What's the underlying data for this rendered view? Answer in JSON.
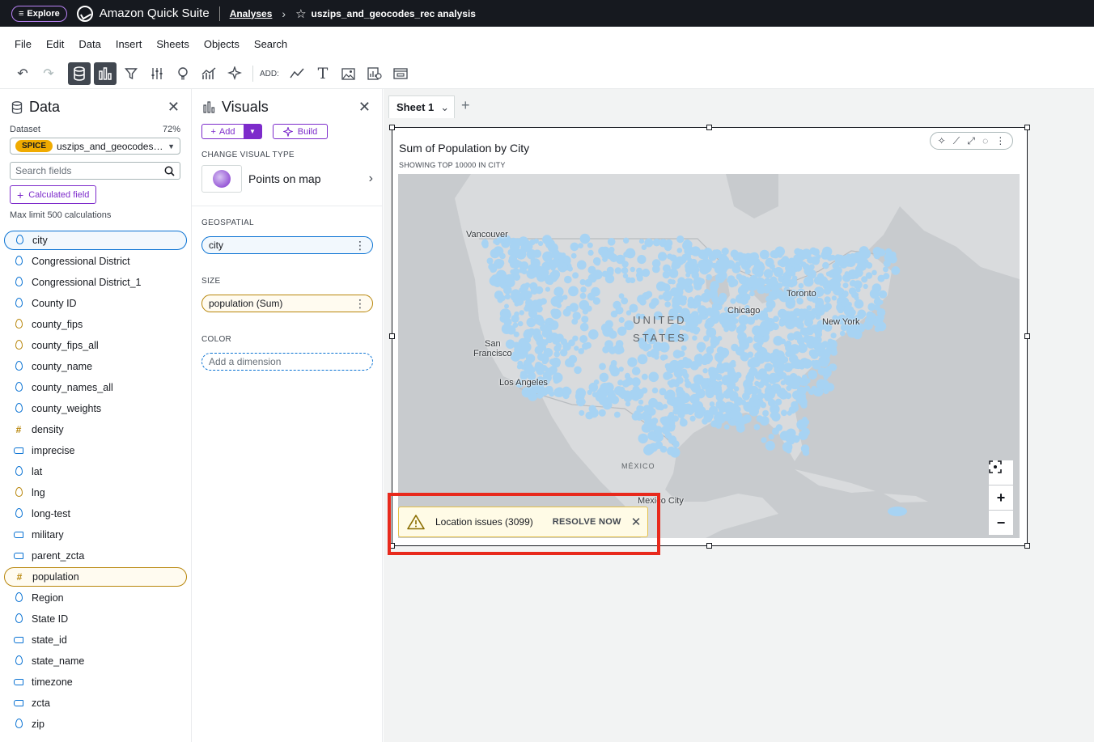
{
  "topbar": {
    "explore_label": "Explore",
    "brand": "Amazon Quick Suite",
    "breadcrumb_link": "Analyses",
    "analysis_title": "uszips_and_geocodes_rec analysis"
  },
  "menu": [
    "File",
    "Edit",
    "Data",
    "Insert",
    "Sheets",
    "Objects",
    "Search"
  ],
  "toolbar": {
    "add_label": "ADD:"
  },
  "data_panel": {
    "title": "Data",
    "dataset_label": "Dataset",
    "dataset_pct": "72%",
    "spice_badge": "SPICE",
    "dataset_name": "uszips_and_geocodes_rec",
    "search_placeholder": "Search fields",
    "calc_button": "Calculated field",
    "max_limit": "Max limit 500 calculations",
    "fields": [
      {
        "name": "city",
        "kind": "dim-geo",
        "selected": "blue"
      },
      {
        "name": "Congressional District",
        "kind": "dim-geo"
      },
      {
        "name": "Congressional District_1",
        "kind": "dim-geo"
      },
      {
        "name": "County ID",
        "kind": "dim-geo"
      },
      {
        "name": "county_fips",
        "kind": "meas-geo"
      },
      {
        "name": "county_fips_all",
        "kind": "meas-geo"
      },
      {
        "name": "county_name",
        "kind": "dim-geo"
      },
      {
        "name": "county_names_all",
        "kind": "dim-geo"
      },
      {
        "name": "county_weights",
        "kind": "dim-geo"
      },
      {
        "name": "density",
        "kind": "meas-num"
      },
      {
        "name": "imprecise",
        "kind": "dim-tag"
      },
      {
        "name": "lat",
        "kind": "dim-geo"
      },
      {
        "name": "lng",
        "kind": "meas-geo"
      },
      {
        "name": "long-test",
        "kind": "dim-geo"
      },
      {
        "name": "military",
        "kind": "dim-tag"
      },
      {
        "name": "parent_zcta",
        "kind": "dim-tag"
      },
      {
        "name": "population",
        "kind": "meas-num",
        "selected": "gold"
      },
      {
        "name": "Region",
        "kind": "dim-geo"
      },
      {
        "name": "State ID",
        "kind": "dim-geo"
      },
      {
        "name": "state_id",
        "kind": "dim-tag"
      },
      {
        "name": "state_name",
        "kind": "dim-geo"
      },
      {
        "name": "timezone",
        "kind": "dim-tag"
      },
      {
        "name": "zcta",
        "kind": "dim-tag"
      },
      {
        "name": "zip",
        "kind": "dim-geo"
      }
    ]
  },
  "visuals_panel": {
    "title": "Visuals",
    "add_label": "Add",
    "build_label": "Build",
    "change_type_label": "CHANGE VISUAL TYPE",
    "visual_type": "Points on map",
    "geospatial_label": "GEOSPATIAL",
    "geospatial_value": "city",
    "size_label": "SIZE",
    "size_value": "population (Sum)",
    "color_label": "COLOR",
    "color_placeholder": "Add a dimension"
  },
  "sheet": {
    "tab_label": "Sheet 1"
  },
  "visual": {
    "title": "Sum of Population by City",
    "subtitle": "SHOWING TOP 10000 IN CITY",
    "map_labels": {
      "vancouver": "Vancouver",
      "toronto": "Toronto",
      "chicago": "Chicago",
      "new_york": "New York",
      "san_francisco": "San\nFrancisco",
      "los_angeles": "Los Angeles",
      "mexico": "MÉXICO",
      "mexico_city": "Mexico City",
      "united_states": "UNITED\nSTATES"
    },
    "zoom_in": "+",
    "zoom_out": "−"
  },
  "location_issues": {
    "text": "Location issues (3099)",
    "action": "RESOLVE NOW"
  },
  "colors": {
    "accent_purple": "#7d2bcb",
    "dimension_blue": "#0972d3",
    "measure_gold": "#b8860b",
    "map_point": "#a7d3f3",
    "highlight_red": "#e8291c"
  }
}
